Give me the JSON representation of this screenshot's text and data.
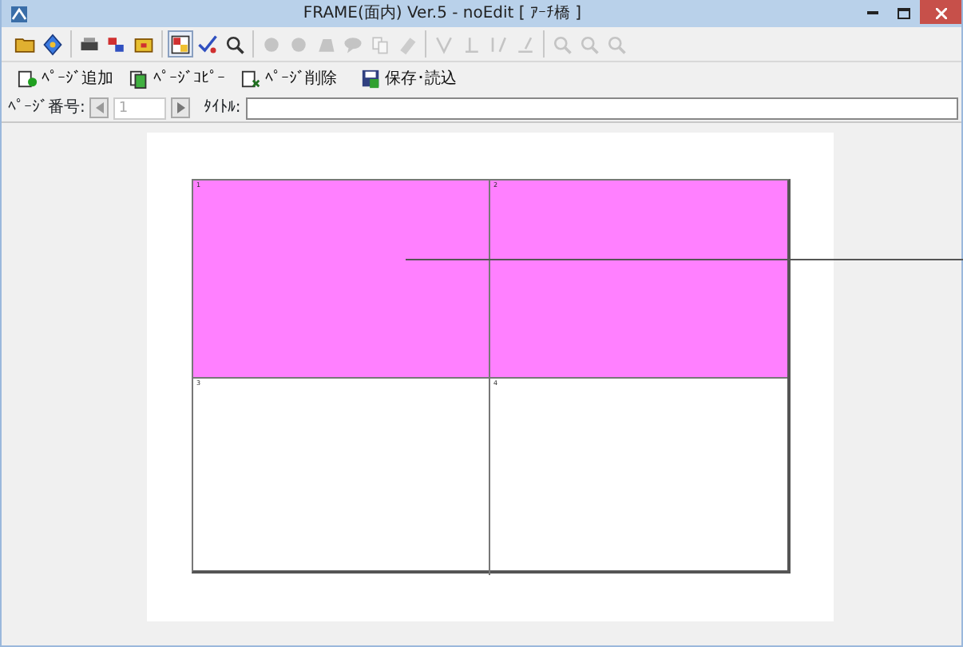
{
  "window": {
    "title": "FRAME(面内) Ver.5 - noEdit [ ｱｰﾁ橋 ]"
  },
  "toolbar": [
    [
      {
        "disabled": false,
        "pressed": false
      },
      {
        "disabled": false,
        "pressed": false
      }
    ],
    [
      {
        "disabled": false,
        "pressed": false
      },
      {
        "disabled": false,
        "pressed": false
      },
      {
        "disabled": false,
        "pressed": false
      }
    ],
    [
      {
        "disabled": false,
        "pressed": true
      },
      {
        "disabled": false,
        "pressed": false
      },
      {
        "disabled": false,
        "pressed": false
      }
    ],
    [
      {
        "disabled": true,
        "pressed": false
      },
      {
        "disabled": true,
        "pressed": false
      },
      {
        "disabled": true,
        "pressed": false
      },
      {
        "disabled": true,
        "pressed": false
      },
      {
        "disabled": true,
        "pressed": false
      },
      {
        "disabled": true,
        "pressed": false
      }
    ],
    [
      {
        "disabled": true,
        "pressed": false
      },
      {
        "disabled": true,
        "pressed": false
      },
      {
        "disabled": true,
        "pressed": false
      },
      {
        "disabled": true,
        "pressed": false
      }
    ],
    [
      {
        "disabled": true,
        "pressed": false
      },
      {
        "disabled": true,
        "pressed": false
      },
      {
        "disabled": true,
        "pressed": false
      }
    ]
  ],
  "page_buttons": [
    {
      "label": "ﾍﾟｰｼﾞ追加"
    },
    {
      "label": "ﾍﾟｰｼﾞｺﾋﾟｰ"
    },
    {
      "label": "ﾍﾟｰｼﾞ削除"
    },
    {
      "label": "保存･読込"
    }
  ],
  "page_bar": {
    "page_label": "ﾍﾟｰｼﾞ番号:",
    "page_number": "1",
    "page_disabled": true,
    "title_label": "ﾀｲﾄﾙ:"
  },
  "panels": [
    {
      "number": "1",
      "selected": true
    },
    {
      "number": "2",
      "selected": true
    },
    {
      "number": "3",
      "selected": false
    },
    {
      "number": "4",
      "selected": false
    }
  ]
}
